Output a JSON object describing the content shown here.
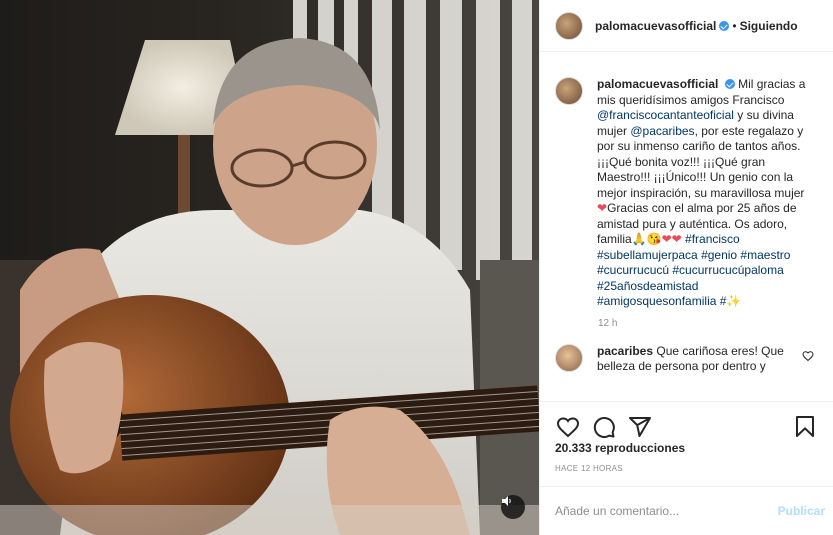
{
  "header": {
    "username": "palomacuevasofficial",
    "separator": "•",
    "follow_status": "Siguiendo"
  },
  "caption": {
    "username": "palomacuevasofficial",
    "part1": "Mil gracias a mis queridísimos amigos Francisco ",
    "mention1": "@franciscocantanteoficial",
    "part2": " y su divina mujer ",
    "mention2": "@pacaribes",
    "part3": ", por este regalazo y por su inmenso cariño de tantos años. ¡¡¡Qué bonita voz!!! ¡¡¡Qué gran Maestro!!! ¡¡¡Único!!! Un genio con la mejor inspiración, su maravillosa mujer",
    "heart1": "❤",
    "part4": "Gracias con el alma por 25 años de amistad pura y auténtica. Os adoro, familia",
    "emojis": "🙏😘❤❤",
    "hashtags": "#francisco #subellamujerpaca #genio #maestro #cucurrucucú #cucurrucucúpaloma #25añosdeamistad #amigosquesonfamilia #✨",
    "time": "12 h"
  },
  "comment": {
    "username": "pacaribes",
    "text": "Que cariñosa eres! Que belleza de persona por dentro y"
  },
  "icons": {
    "like": "heart-icon",
    "comment": "comment-icon",
    "share": "share-icon",
    "save": "bookmark-icon",
    "mute": "speaker-icon"
  },
  "stats": {
    "views": "20.333 reproducciones",
    "ago": "HACE 12 HORAS"
  },
  "add_comment": {
    "placeholder": "Añade un comentario...",
    "post_label": "Publicar"
  },
  "colors": {
    "link": "#00376b",
    "verified": "#3897f0",
    "post_disabled": "#b2dffc",
    "heart": "#ed4956"
  }
}
